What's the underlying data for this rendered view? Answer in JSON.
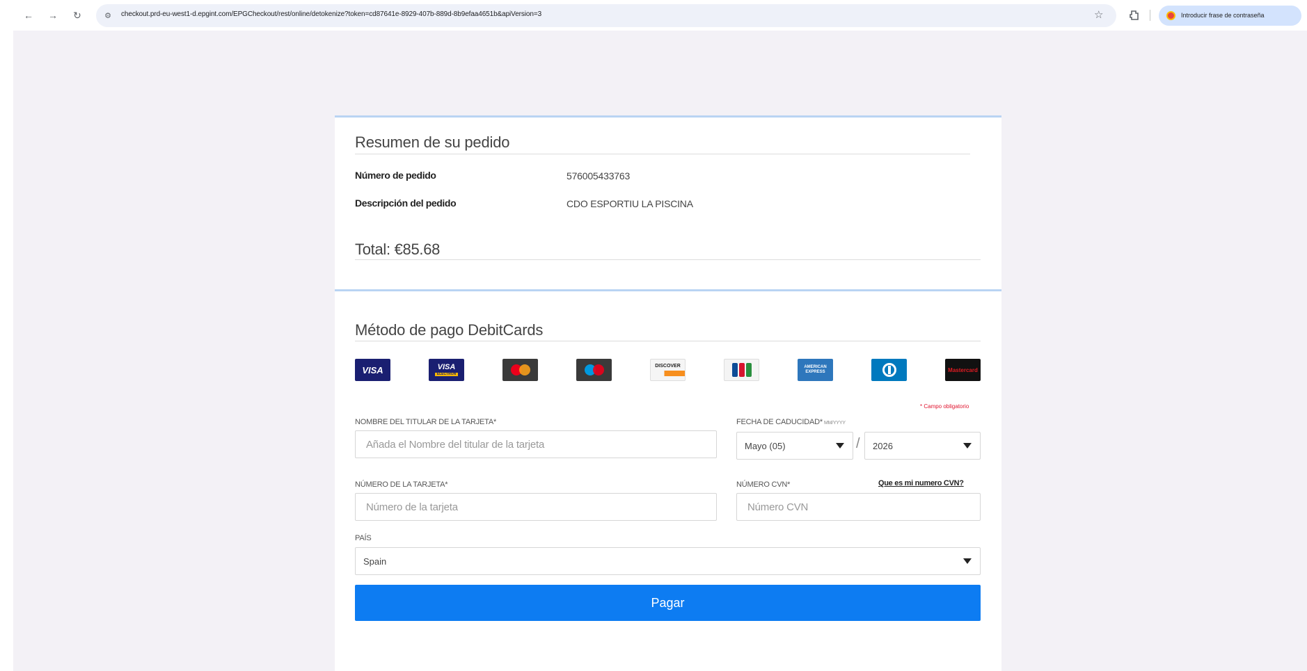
{
  "browser": {
    "url": "checkout.prd-eu-west1-d.epgint.com/EPGCheckout/rest/online/detokenize?token=cd87641e-8929-407b-889d-8b9efaa4651b&apiVersion=3",
    "password_prompt": "Introducir frase de contraseña"
  },
  "summary": {
    "title": "Resumen de su pedido",
    "order_number_label": "Número de pedido",
    "order_number_value": "576005433763",
    "order_desc_label": "Descripción del pedido",
    "order_desc_value": "CDO ESPORTIU LA PISCINA",
    "total": "Total: €85.68"
  },
  "payment": {
    "title": "Método de pago DebitCards",
    "card_logos": [
      {
        "name": "visa",
        "text": "VISA"
      },
      {
        "name": "visa-electron",
        "text": "VISA",
        "sub": "ELECTRON"
      },
      {
        "name": "mastercard",
        "colors": [
          "#eb001b",
          "#f79e1b"
        ]
      },
      {
        "name": "maestro",
        "colors": [
          "#0099df",
          "#ea001b"
        ]
      },
      {
        "name": "discover",
        "text": "DISCOVER"
      },
      {
        "name": "jcb",
        "colors": [
          "#0e4c96",
          "#d7142e",
          "#2a8f3e"
        ]
      },
      {
        "name": "american-express",
        "text": "AMERICAN EXPRESS"
      },
      {
        "name": "diners-club"
      },
      {
        "name": "other-card",
        "text": "Mastercard"
      }
    ],
    "required_note": "* Campo obligatorio",
    "cardholder_label": "NOMBRE DEL TITULAR DE LA TARJETA*",
    "cardholder_placeholder": "Añada el Nombre del titular de la tarjeta",
    "expiry_label": "FECHA DE CADUCIDAD*",
    "expiry_hint": "MM/YYYY",
    "expiry_month": "Mayo (05)",
    "expiry_year": "2026",
    "card_number_label": "NÚMERO DE LA TARJETA*",
    "card_number_placeholder": "Número de la tarjeta",
    "cvn_label": "NÚMERO CVN*",
    "cvn_link": "Que es mi numero CVN?",
    "cvn_placeholder": "Número CVN",
    "country_label": "PAÍS",
    "country_value": "Spain",
    "pay_button": "Pagar"
  }
}
